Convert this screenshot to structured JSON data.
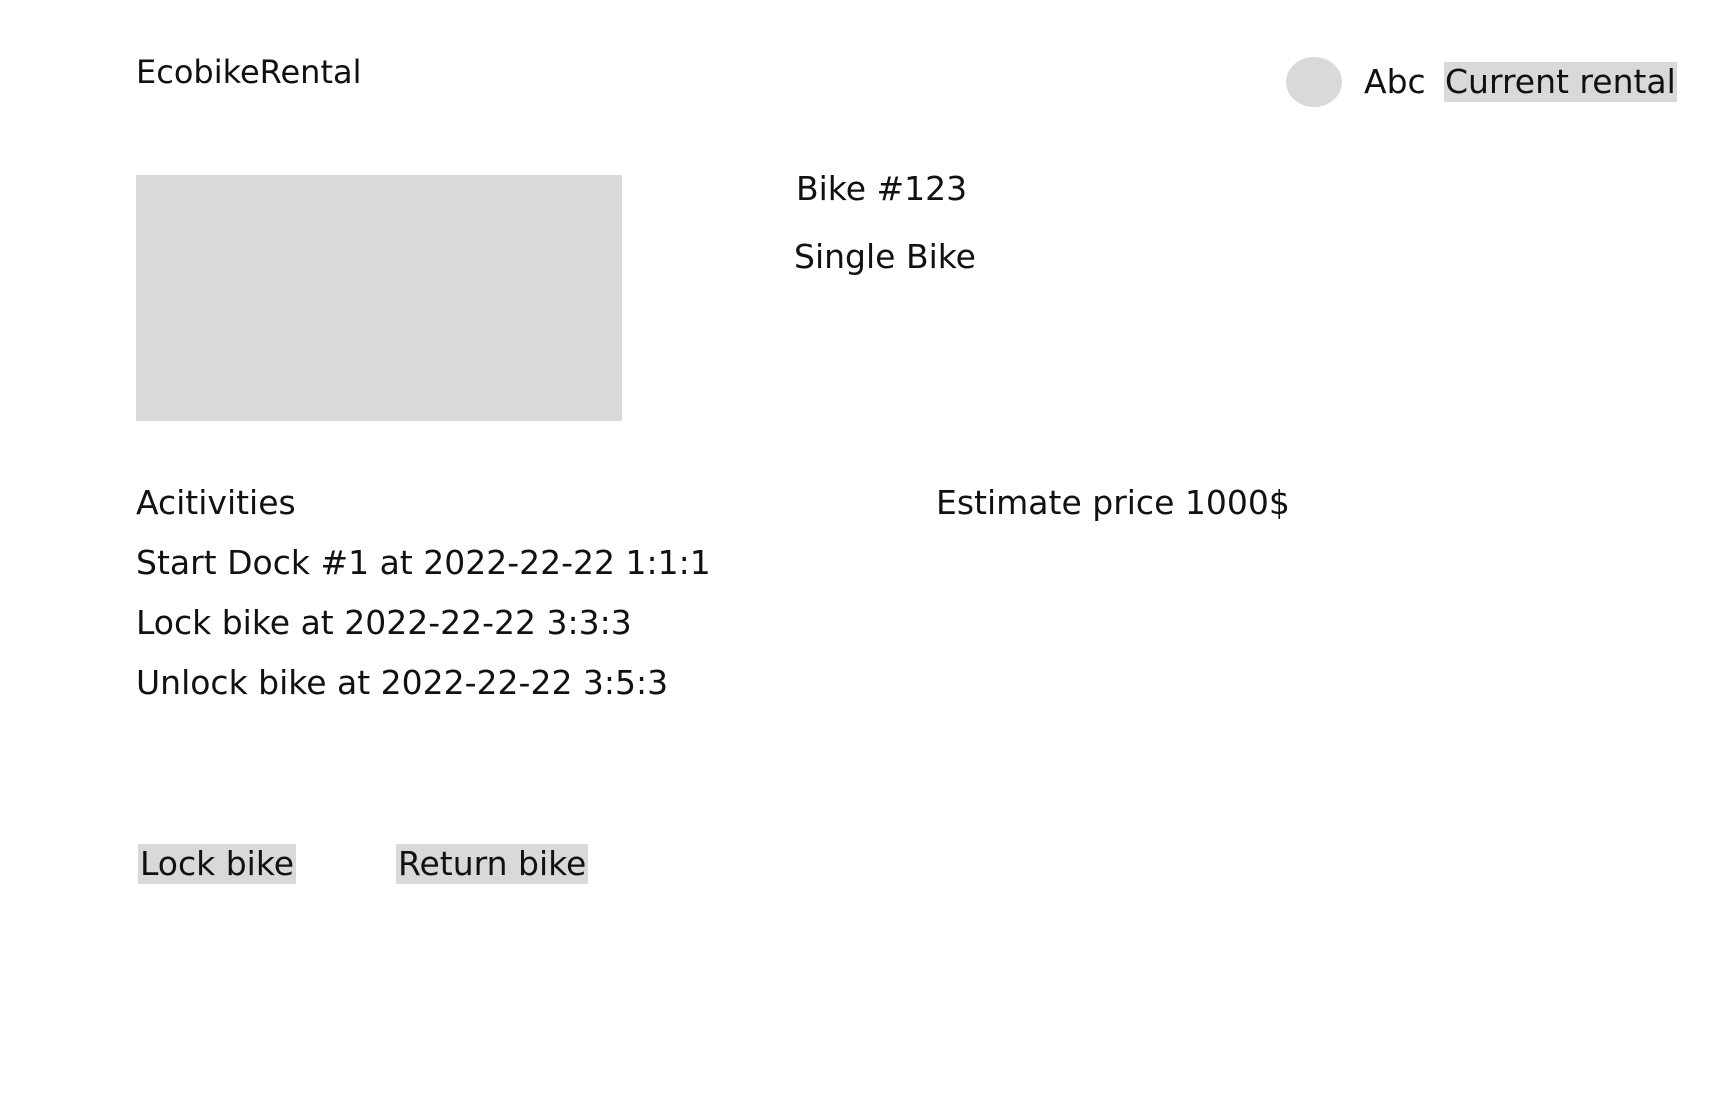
{
  "header": {
    "brand": "EcobikeRental",
    "username": "Abc",
    "current_rental_label": "Current rental"
  },
  "bike": {
    "id_label": "Bike #123",
    "type_label": "Single Bike"
  },
  "activities": {
    "title": "Acitivities",
    "items": [
      "Start Dock #1 at  2022-22-22 1:1:1",
      "Lock bike at 2022-22-22 3:3:3",
      "Unlock bike at 2022-22-22 3:5:3"
    ]
  },
  "estimate": {
    "label": "Estimate price 1000$"
  },
  "actions": {
    "lock_label": "Lock bike",
    "return_label": "Return bike"
  },
  "colors": {
    "placeholder": "#d9d9d9",
    "text": "#111111",
    "background": "#ffffff"
  }
}
